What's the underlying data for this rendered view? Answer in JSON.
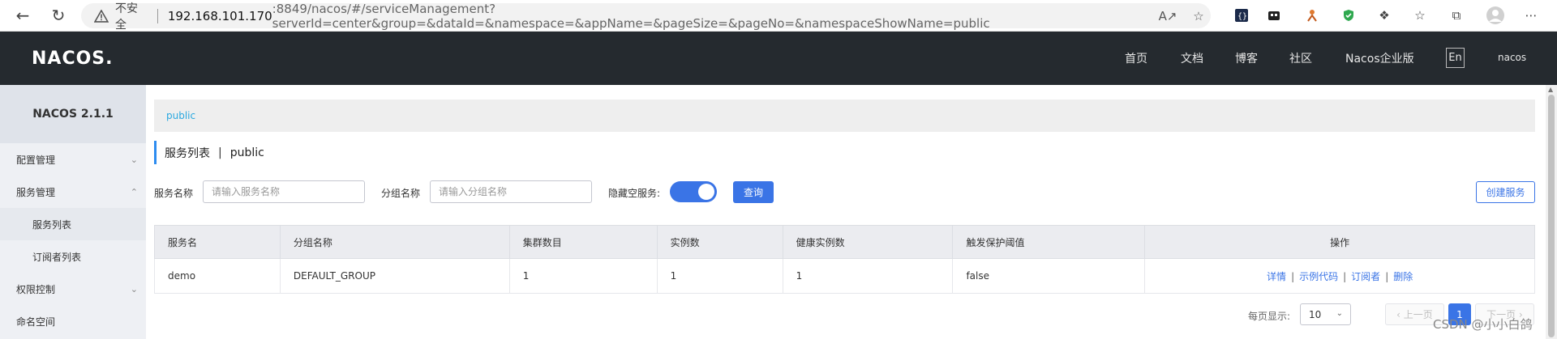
{
  "browser": {
    "insecure_label": "不安全",
    "url_host": "192.168.101.170",
    "url_rest": ":8849/nacos/#/serviceManagement?serverId=center&group=&dataId=&namespace=&appName=&pageSize=&pageNo=&namespaceShowName=public"
  },
  "header": {
    "logo": "NACOS.",
    "nav": [
      "首页",
      "文档",
      "博客",
      "社区",
      "Nacos企业版"
    ],
    "lang": "En",
    "user": "nacos"
  },
  "sidebar": {
    "title": "NACOS 2.1.1",
    "items": [
      {
        "label": "配置管理",
        "chevron": "down"
      },
      {
        "label": "服务管理",
        "chevron": "up"
      },
      {
        "label": "服务列表"
      },
      {
        "label": "订阅者列表"
      },
      {
        "label": "权限控制",
        "chevron": "down"
      },
      {
        "label": "命名空间"
      }
    ]
  },
  "main": {
    "breadcrumb": "public",
    "title": "服务列表",
    "title_sep": "|",
    "namespace": "public",
    "filters": {
      "service_label": "服务名称",
      "service_placeholder": "请输入服务名称",
      "group_label": "分组名称",
      "group_placeholder": "请输入分组名称",
      "hide_empty_label": "隐藏空服务:",
      "hide_empty_on": true,
      "query_button": "查询",
      "create_button": "创建服务"
    },
    "table": {
      "columns": [
        "服务名",
        "分组名称",
        "集群数目",
        "实例数",
        "健康实例数",
        "触发保护阈值",
        "操作"
      ],
      "rows": [
        {
          "cells": [
            "demo",
            "DEFAULT_GROUP",
            "1",
            "1",
            "1",
            "false"
          ],
          "ops": [
            "详情",
            "示例代码",
            "订阅者",
            "删除"
          ]
        }
      ]
    },
    "pager": {
      "page_size_label": "每页显示:",
      "page_size": "10",
      "prev": "上一页",
      "current": "1",
      "next": "下一页"
    }
  },
  "watermark": "CSDN @小小白鸽",
  "colors": {
    "accent": "#3a74e6",
    "header_bg": "#252a2f",
    "link": "#29a8e0"
  }
}
